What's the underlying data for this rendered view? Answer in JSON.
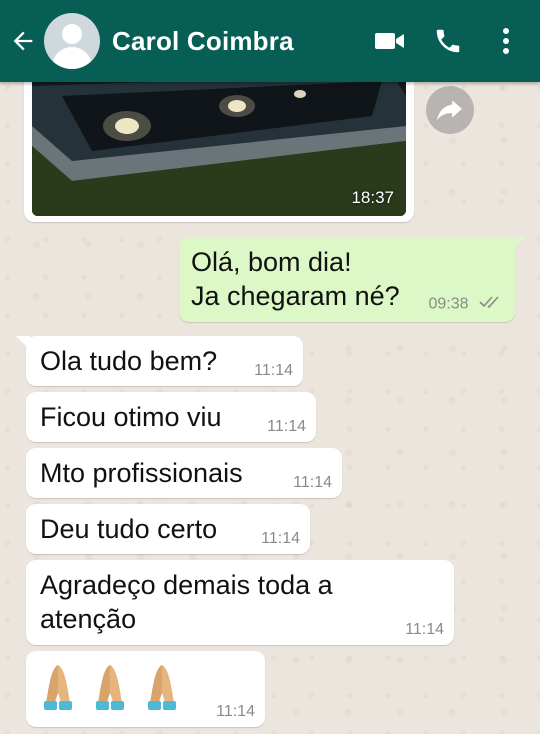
{
  "header": {
    "contact_name": "Carol Coimbra",
    "icons": [
      "back-arrow-icon",
      "avatar",
      "video-call-icon",
      "phone-icon",
      "more-vert-icon"
    ],
    "color": "#075e54"
  },
  "media_message": {
    "time": "18:37"
  },
  "messages": [
    {
      "direction": "out",
      "lines": [
        "Olá, bom dia!",
        "Ja chegaram né?"
      ],
      "time": "09:38",
      "status": "read"
    },
    {
      "direction": "in",
      "text": "Ola tudo bem?",
      "time": "11:14"
    },
    {
      "direction": "in",
      "text": "Ficou otimo viu",
      "time": "11:14"
    },
    {
      "direction": "in",
      "text": "Mto profissionais",
      "time": "11:14"
    },
    {
      "direction": "in",
      "text": "Deu tudo certo",
      "time": "11:14"
    },
    {
      "direction": "in",
      "lines": [
        "Agradeço demais toda a",
        "atenção"
      ],
      "time": "11:14"
    },
    {
      "direction": "in",
      "emoji": "folded-hands-icon x3",
      "time": "11:14"
    }
  ],
  "colors": {
    "outgoing_bubble": "#dcf8c6",
    "incoming_bubble": "#ffffff",
    "chat_background": "#ece5dd"
  }
}
